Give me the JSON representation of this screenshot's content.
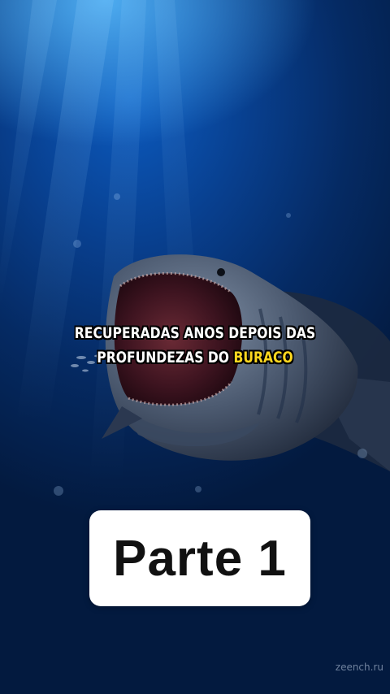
{
  "caption": {
    "line1": "RECUPERADAS ANOS DEPOIS DAS",
    "line2_prefix": "PROFUNDEZAS DO ",
    "line2_highlight": "BURACO"
  },
  "card": {
    "label": "Parte 1"
  },
  "watermark": {
    "text": "zeench.ru"
  },
  "colors": {
    "highlight": "#ffd81f",
    "water_deep": "#031a3f",
    "water_light": "#0c5bc0"
  }
}
